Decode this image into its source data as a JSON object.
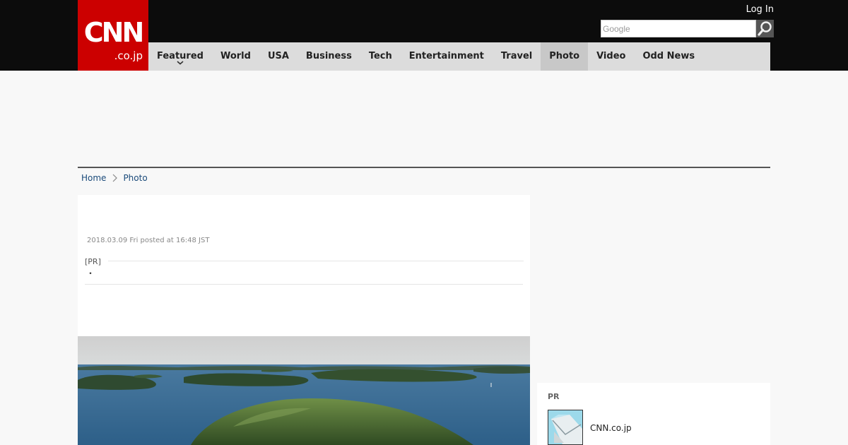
{
  "header": {
    "logo_text": "CNN",
    "logo_sub": ".co.jp",
    "login_label": "Log In",
    "search_placeholder": "Google",
    "brand_color": "#cc0000",
    "bar_color": "#0c0c0c",
    "search_icon": "magnifier-icon"
  },
  "nav": {
    "items": [
      {
        "label": "Featured",
        "has_dropdown": true
      },
      {
        "label": "World"
      },
      {
        "label": "USA"
      },
      {
        "label": "Business"
      },
      {
        "label": "Tech"
      },
      {
        "label": "Entertainment"
      },
      {
        "label": "Travel"
      },
      {
        "label": "Photo",
        "active": true
      },
      {
        "label": "Video"
      },
      {
        "label": "Odd News"
      }
    ]
  },
  "breadcrumb": {
    "home": "Home",
    "current": "Photo",
    "separator_icon": "chevron-right-icon"
  },
  "article": {
    "date": "2018.03.09 Fri posted at 16:48 JST",
    "pr_label": "[PR]",
    "pr_text": "・"
  },
  "sidebar": {
    "pr_title": "PR",
    "link_label": "CNN.co.jp"
  }
}
